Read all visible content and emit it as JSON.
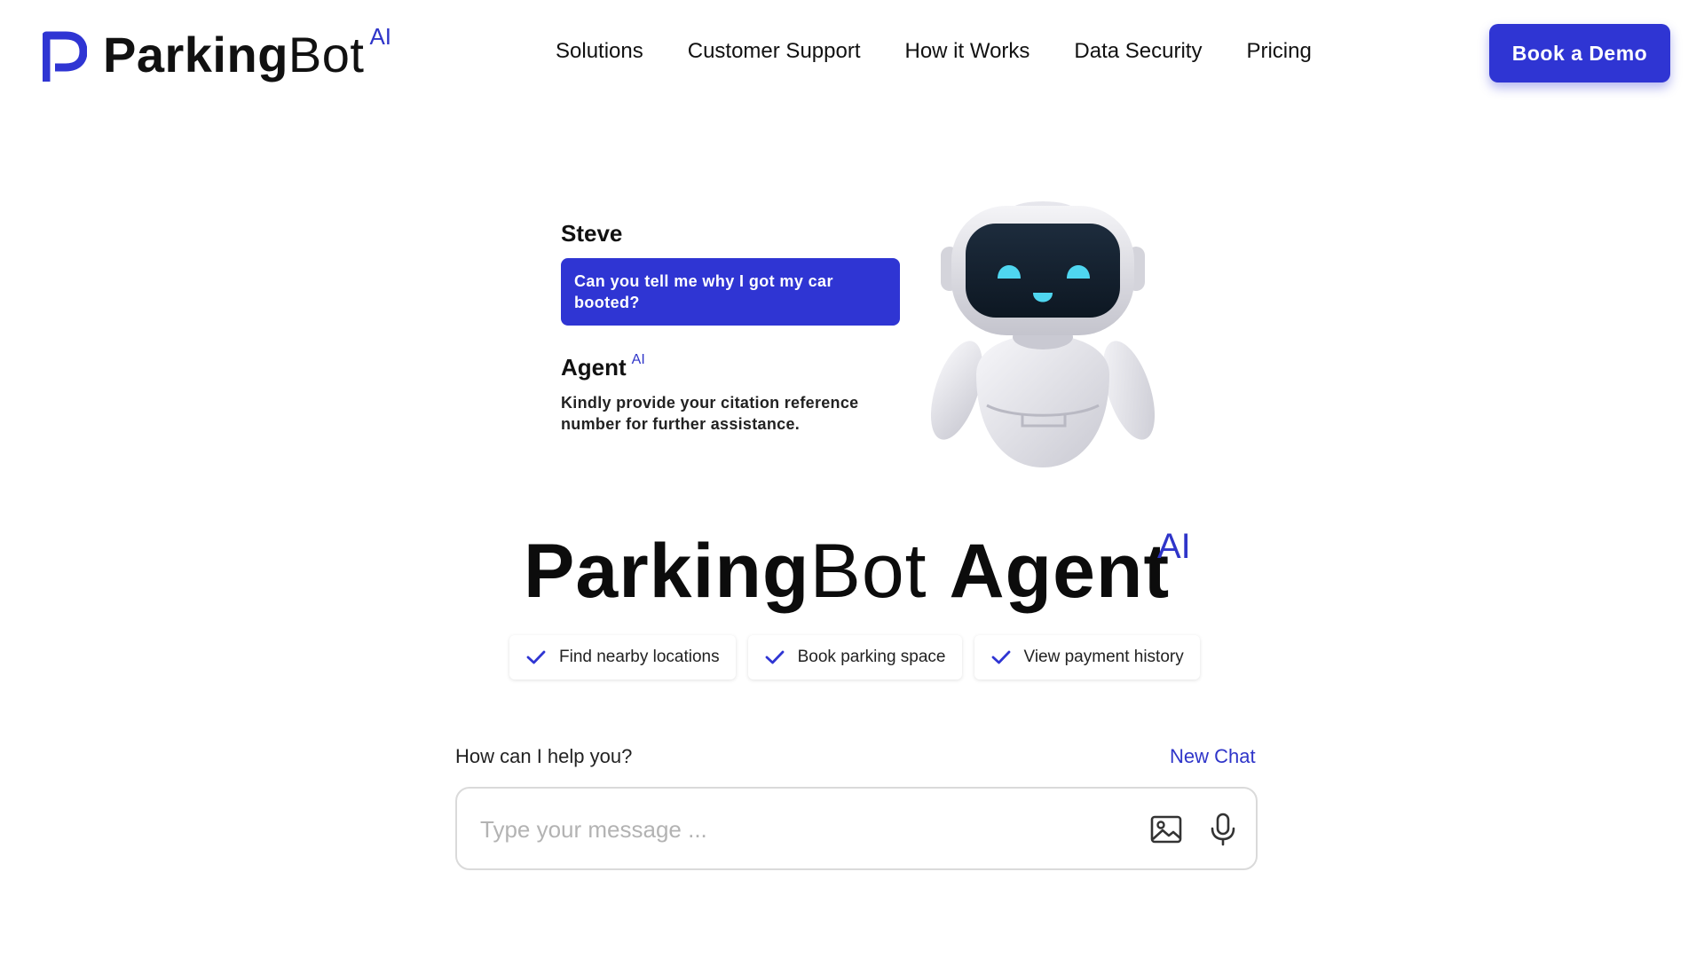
{
  "brand": {
    "name_bold": "Parking",
    "name_regular": "Bot",
    "superscript": "AI",
    "accent_color": "#2f35d3"
  },
  "nav": {
    "items": [
      "Solutions",
      "Customer Support",
      "How it Works",
      "Data Security",
      "Pricing"
    ]
  },
  "header": {
    "cta_label": "Book a Demo"
  },
  "chat_preview": {
    "user_name": "Steve",
    "user_message": "Can you tell me why I got my car booted?",
    "agent_name": "Agent",
    "agent_superscript": "AI",
    "agent_message": "Kindly provide your citation reference number for further assistance."
  },
  "hero": {
    "title_bold": "Parking",
    "title_regular": "Bot",
    "title_suffix": "Agent",
    "superscript": "AI"
  },
  "features": [
    {
      "label": "Find nearby locations",
      "icon": "check-icon"
    },
    {
      "label": "Book parking space",
      "icon": "check-icon"
    },
    {
      "label": "View payment history",
      "icon": "check-icon"
    }
  ],
  "chat_input": {
    "prompt_label": "How can I help you?",
    "new_chat_label": "New Chat",
    "placeholder": "Type your message ...",
    "value": "",
    "icons": [
      "image-icon",
      "microphone-icon"
    ]
  }
}
